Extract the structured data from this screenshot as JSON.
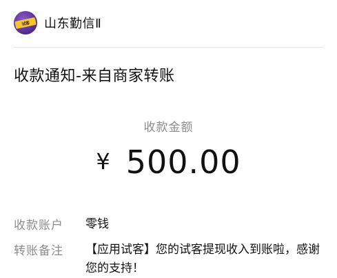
{
  "header": {
    "avatar_icon": "brand-logo-icon",
    "avatar_text": "试客",
    "account_name": "山东勤信Ⅱ"
  },
  "notification": {
    "title": "收款通知-来自商家转账"
  },
  "amount": {
    "label": "收款金额",
    "currency": "¥",
    "value": "500.00"
  },
  "details": {
    "account_label": "收款账户",
    "account_value": "零钱",
    "remark_label": "转账备注",
    "remark_value": "【应用试客】您的试客提现收入到账啦，感谢您的支持！"
  },
  "colors": {
    "primary_text": "#111111",
    "secondary_text": "#8c8c8c",
    "avatar_bg": "#5a2f96",
    "avatar_ribbon": "#f5c431"
  }
}
